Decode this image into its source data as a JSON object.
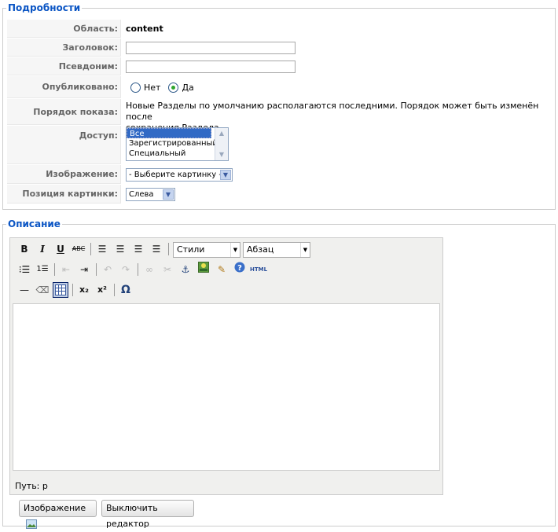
{
  "details": {
    "legend": "Подробности",
    "scope_label": "Область:",
    "scope_value": "content",
    "title_label": "Заголовок:",
    "title_value": "",
    "alias_label": "Псевдоним:",
    "alias_value": "",
    "published_label": "Опубликовано:",
    "published_options": [
      "Нет",
      "Да"
    ],
    "published_selected": "Да",
    "order_label": "Порядок показа:",
    "order_text_1": "Новые Разделы по умолчанию располагаются последними. Порядок может быть изменён после",
    "order_text_2": "сохранения Раздела.",
    "access_label": "Доступ:",
    "access_options": [
      "Все",
      "Зарегистрированный",
      "Специальный"
    ],
    "access_selected": "Все",
    "image_label": "Изображение:",
    "image_value": "- Выберите картинку -",
    "image_pos_label": "Позиция картинки:",
    "image_pos_value": "Слева"
  },
  "description": {
    "legend": "Описание",
    "toolbar": {
      "bold": "B",
      "italic": "I",
      "underline": "U",
      "strike": "ABC",
      "styles": "Стили",
      "format": "Абзац",
      "html": "HTML",
      "sub": "x₂",
      "sup": "x²",
      "charmap": "Ω"
    },
    "path_label": "Путь: p",
    "image_button": "Изображение",
    "toggle_editor_button": "Выключить редактор"
  }
}
